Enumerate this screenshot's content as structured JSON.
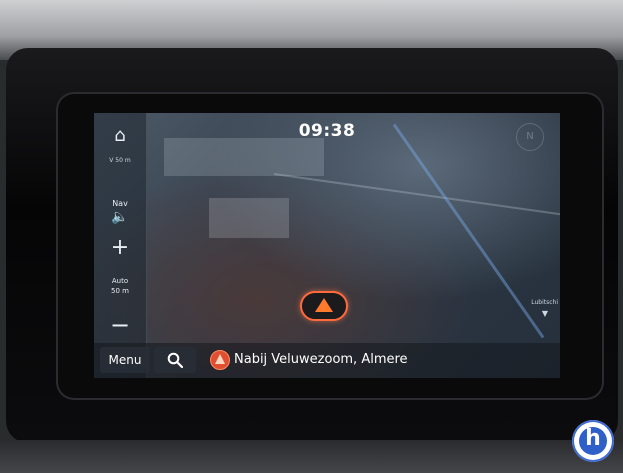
{
  "status": {
    "clock": "09:38"
  },
  "sidebar": {
    "home_icon": "home-icon",
    "scale_text": "V 50 m",
    "nav_label": "Nav",
    "volume_icon": "speaker-icon",
    "zoom_in_icon": "+",
    "auto_label": "Auto",
    "auto_value": "50 m",
    "zoom_out_icon": "−"
  },
  "map": {
    "poi_label": "Lubitschi",
    "position_marker": "navigation-arrow-icon"
  },
  "bottom_bar": {
    "menu_label": "Menu",
    "search_icon": "search-icon",
    "location_text": "Nabij Veluwezoom, Almere"
  },
  "colors": {
    "accent_orange": "#ff6a3c",
    "logo_blue": "#2f5fc9"
  }
}
